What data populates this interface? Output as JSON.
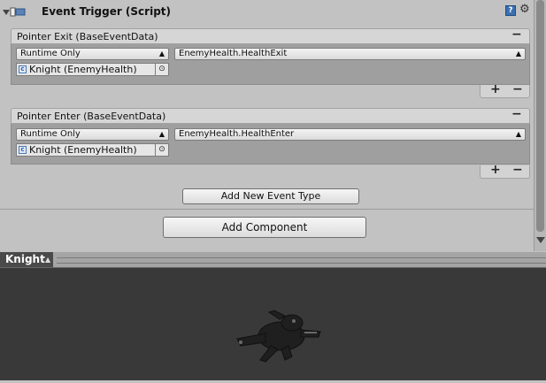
{
  "component": {
    "title": "Event Trigger (Script)",
    "help_icon": "?"
  },
  "events": [
    {
      "title": "Pointer Exit (BaseEventData)",
      "runtime": "Runtime Only",
      "function": "EnemyHealth.HealthExit",
      "object": "Knight (EnemyHealth)"
    },
    {
      "title": "Pointer Enter (BaseEventData)",
      "runtime": "Runtime Only",
      "function": "EnemyHealth.HealthEnter",
      "object": "Knight (EnemyHealth)"
    }
  ],
  "buttons": {
    "add_event": "Add New Event Type",
    "add_component": "Add Component",
    "plus": "+",
    "minus": "−",
    "remove": "−"
  },
  "preview": {
    "tab_label": "Knight"
  },
  "icons": {
    "foldout": "foldout-arrow-icon",
    "script": "script-component-icon",
    "help": "help-book-icon",
    "gear": "gear-icon",
    "dropdown": "dropdown-arrows-icon",
    "object_picker": "object-picker-icon",
    "csharp": "csharp-script-icon"
  }
}
